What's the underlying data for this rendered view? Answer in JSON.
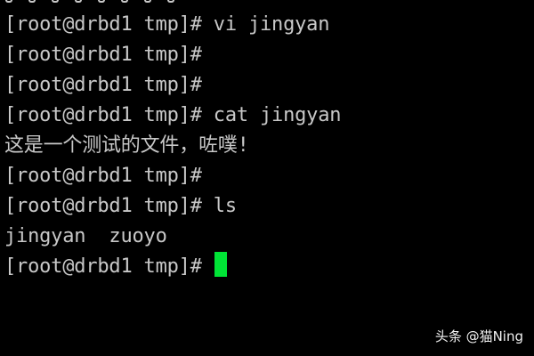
{
  "terminal": {
    "lines": [
      "[root@drbd1 tmp]# vi jingyan",
      "[root@drbd1 tmp]#",
      "[root@drbd1 tmp]#",
      "[root@drbd1 tmp]# cat jingyan",
      "这是一个测试的文件，咗噗!",
      "[root@drbd1 tmp]#",
      "[root@drbd1 tmp]# ls",
      "jingyan  zuoyo",
      "[root@drbd1 tmp]# "
    ],
    "cursor_color": "#00e436",
    "text_color": "#c8c8c8",
    "background_color": "#000000"
  },
  "watermark": {
    "text": "头条 @猫Ning"
  }
}
